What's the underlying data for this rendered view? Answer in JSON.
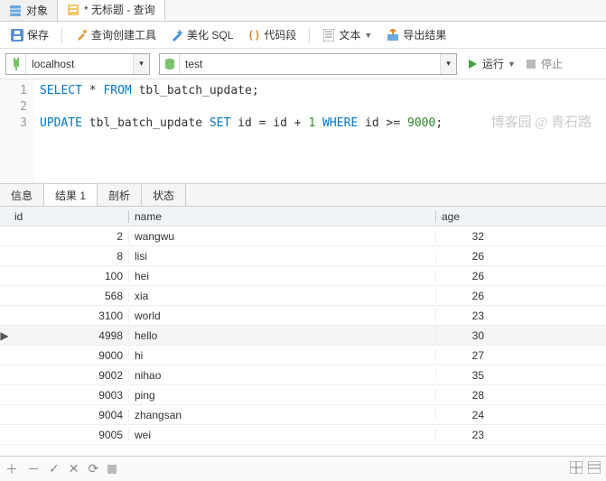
{
  "top_tabs": {
    "objects": "对象",
    "query_title": "* 无标题 - 查询"
  },
  "toolbar": {
    "save": "保存",
    "query_builder": "查询创建工具",
    "beautify": "美化 SQL",
    "snippet": "代码段",
    "text": "文本",
    "export": "导出结果"
  },
  "conn": {
    "server": "localhost",
    "db": "test",
    "run": "运行",
    "stop": "停止"
  },
  "editor": {
    "lines": [
      "1",
      "2",
      "3"
    ],
    "l1_select": "SELECT",
    "l1_star": " * ",
    "l1_from": "FROM",
    "l1_tbl": " tbl_batch_update;",
    "l3_update": "UPDATE",
    "l3_tbl": " tbl_batch_update ",
    "l3_set": "SET",
    "l3_id1": " id = id + ",
    "l3_one": "1",
    "l3_sp": " ",
    "l3_where": "WHERE",
    "l3_id2": " id >= ",
    "l3_num": "9000",
    "l3_semi": ";"
  },
  "watermark": "博客园 @ 青石路",
  "result_tabs": {
    "info": "信息",
    "result": "结果 1",
    "profile": "剖析",
    "status": "状态"
  },
  "columns": {
    "id": "id",
    "name": "name",
    "age": "age"
  },
  "rows": [
    {
      "id": "2",
      "name": "wangwu",
      "age": "32"
    },
    {
      "id": "8",
      "name": "lisi",
      "age": "26"
    },
    {
      "id": "100",
      "name": "hei",
      "age": "26"
    },
    {
      "id": "568",
      "name": "xia",
      "age": "26"
    },
    {
      "id": "3100",
      "name": "world",
      "age": "23"
    },
    {
      "id": "4998",
      "name": "hello",
      "age": "30",
      "sel": true
    },
    {
      "id": "9000",
      "name": "hi",
      "age": "27"
    },
    {
      "id": "9002",
      "name": "nihao",
      "age": "35"
    },
    {
      "id": "9003",
      "name": "ping",
      "age": "28"
    },
    {
      "id": "9004",
      "name": "zhangsan",
      "age": "24"
    },
    {
      "id": "9005",
      "name": "wei",
      "age": "23"
    }
  ]
}
